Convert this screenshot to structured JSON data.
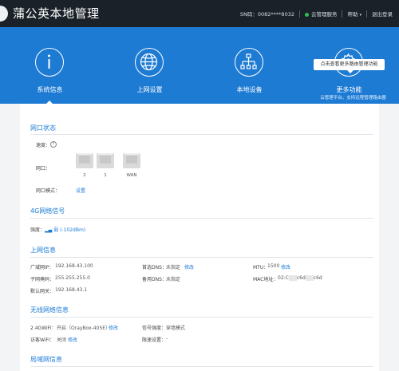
{
  "header": {
    "title": "蒲公英本地管理",
    "sn": "SN码：0082****8032",
    "cloud_service": "云管理服务",
    "help": "帮助",
    "logout": "退出登录",
    "help_caret": "▾"
  },
  "nav": {
    "items": [
      {
        "label": "系统信息",
        "icon": "info-icon"
      },
      {
        "label": "上网设置",
        "icon": "globe-icon"
      },
      {
        "label": "本地设备",
        "icon": "network-tree-icon"
      },
      {
        "label": "更多功能",
        "icon": "gear-icon"
      }
    ],
    "more_sub": "云管理平台，支持远程管理路由器",
    "tooltip": "点击查看更多路由管理功能",
    "active": 0
  },
  "port_status": {
    "title": "网口状态",
    "speed_label": "速度：",
    "port_label": "网口：",
    "ports": [
      "2",
      "1",
      "WAN"
    ],
    "mode_label": "网口模式：",
    "mode_link": "设置"
  },
  "signal": {
    "title": "4G网络信号",
    "strength_label": "强度：",
    "strength_value": "弱",
    "strength_dbm": "(-102dBm)"
  },
  "internet": {
    "title": "上网信息",
    "wan_ip_label": "广域网IP：",
    "wan_ip": "192.168.43.100",
    "subnet_label": "子网掩码：",
    "subnet": "255.255.255.0",
    "gateway_label": "默认网关：",
    "gateway": "192.168.43.1",
    "dns1_label": "首选DNS：",
    "dns1": "未指定",
    "dns2_label": "备用DNS：",
    "dns2": "未指定",
    "mtu_label": "MTU：",
    "mtu": "1500",
    "mac_label": "MAC地址：",
    "mac_start": "02:C",
    "mac_mid": "c6d",
    "mac_end": "c6d",
    "edit": "修改"
  },
  "wireless": {
    "title": "无线网络信息",
    "wifi24_label": "2.4GWiFi：",
    "wifi24_value": "开启（OrayBox-405E）",
    "guest_label": "访客WiFi：",
    "guest_value": "关闭",
    "signal_label": "信号强度：",
    "signal_value": "穿墙模式",
    "speed_label": "限速设置：",
    "speed_value": "-",
    "edit": "修改"
  },
  "lan": {
    "title": "局域网信息"
  }
}
